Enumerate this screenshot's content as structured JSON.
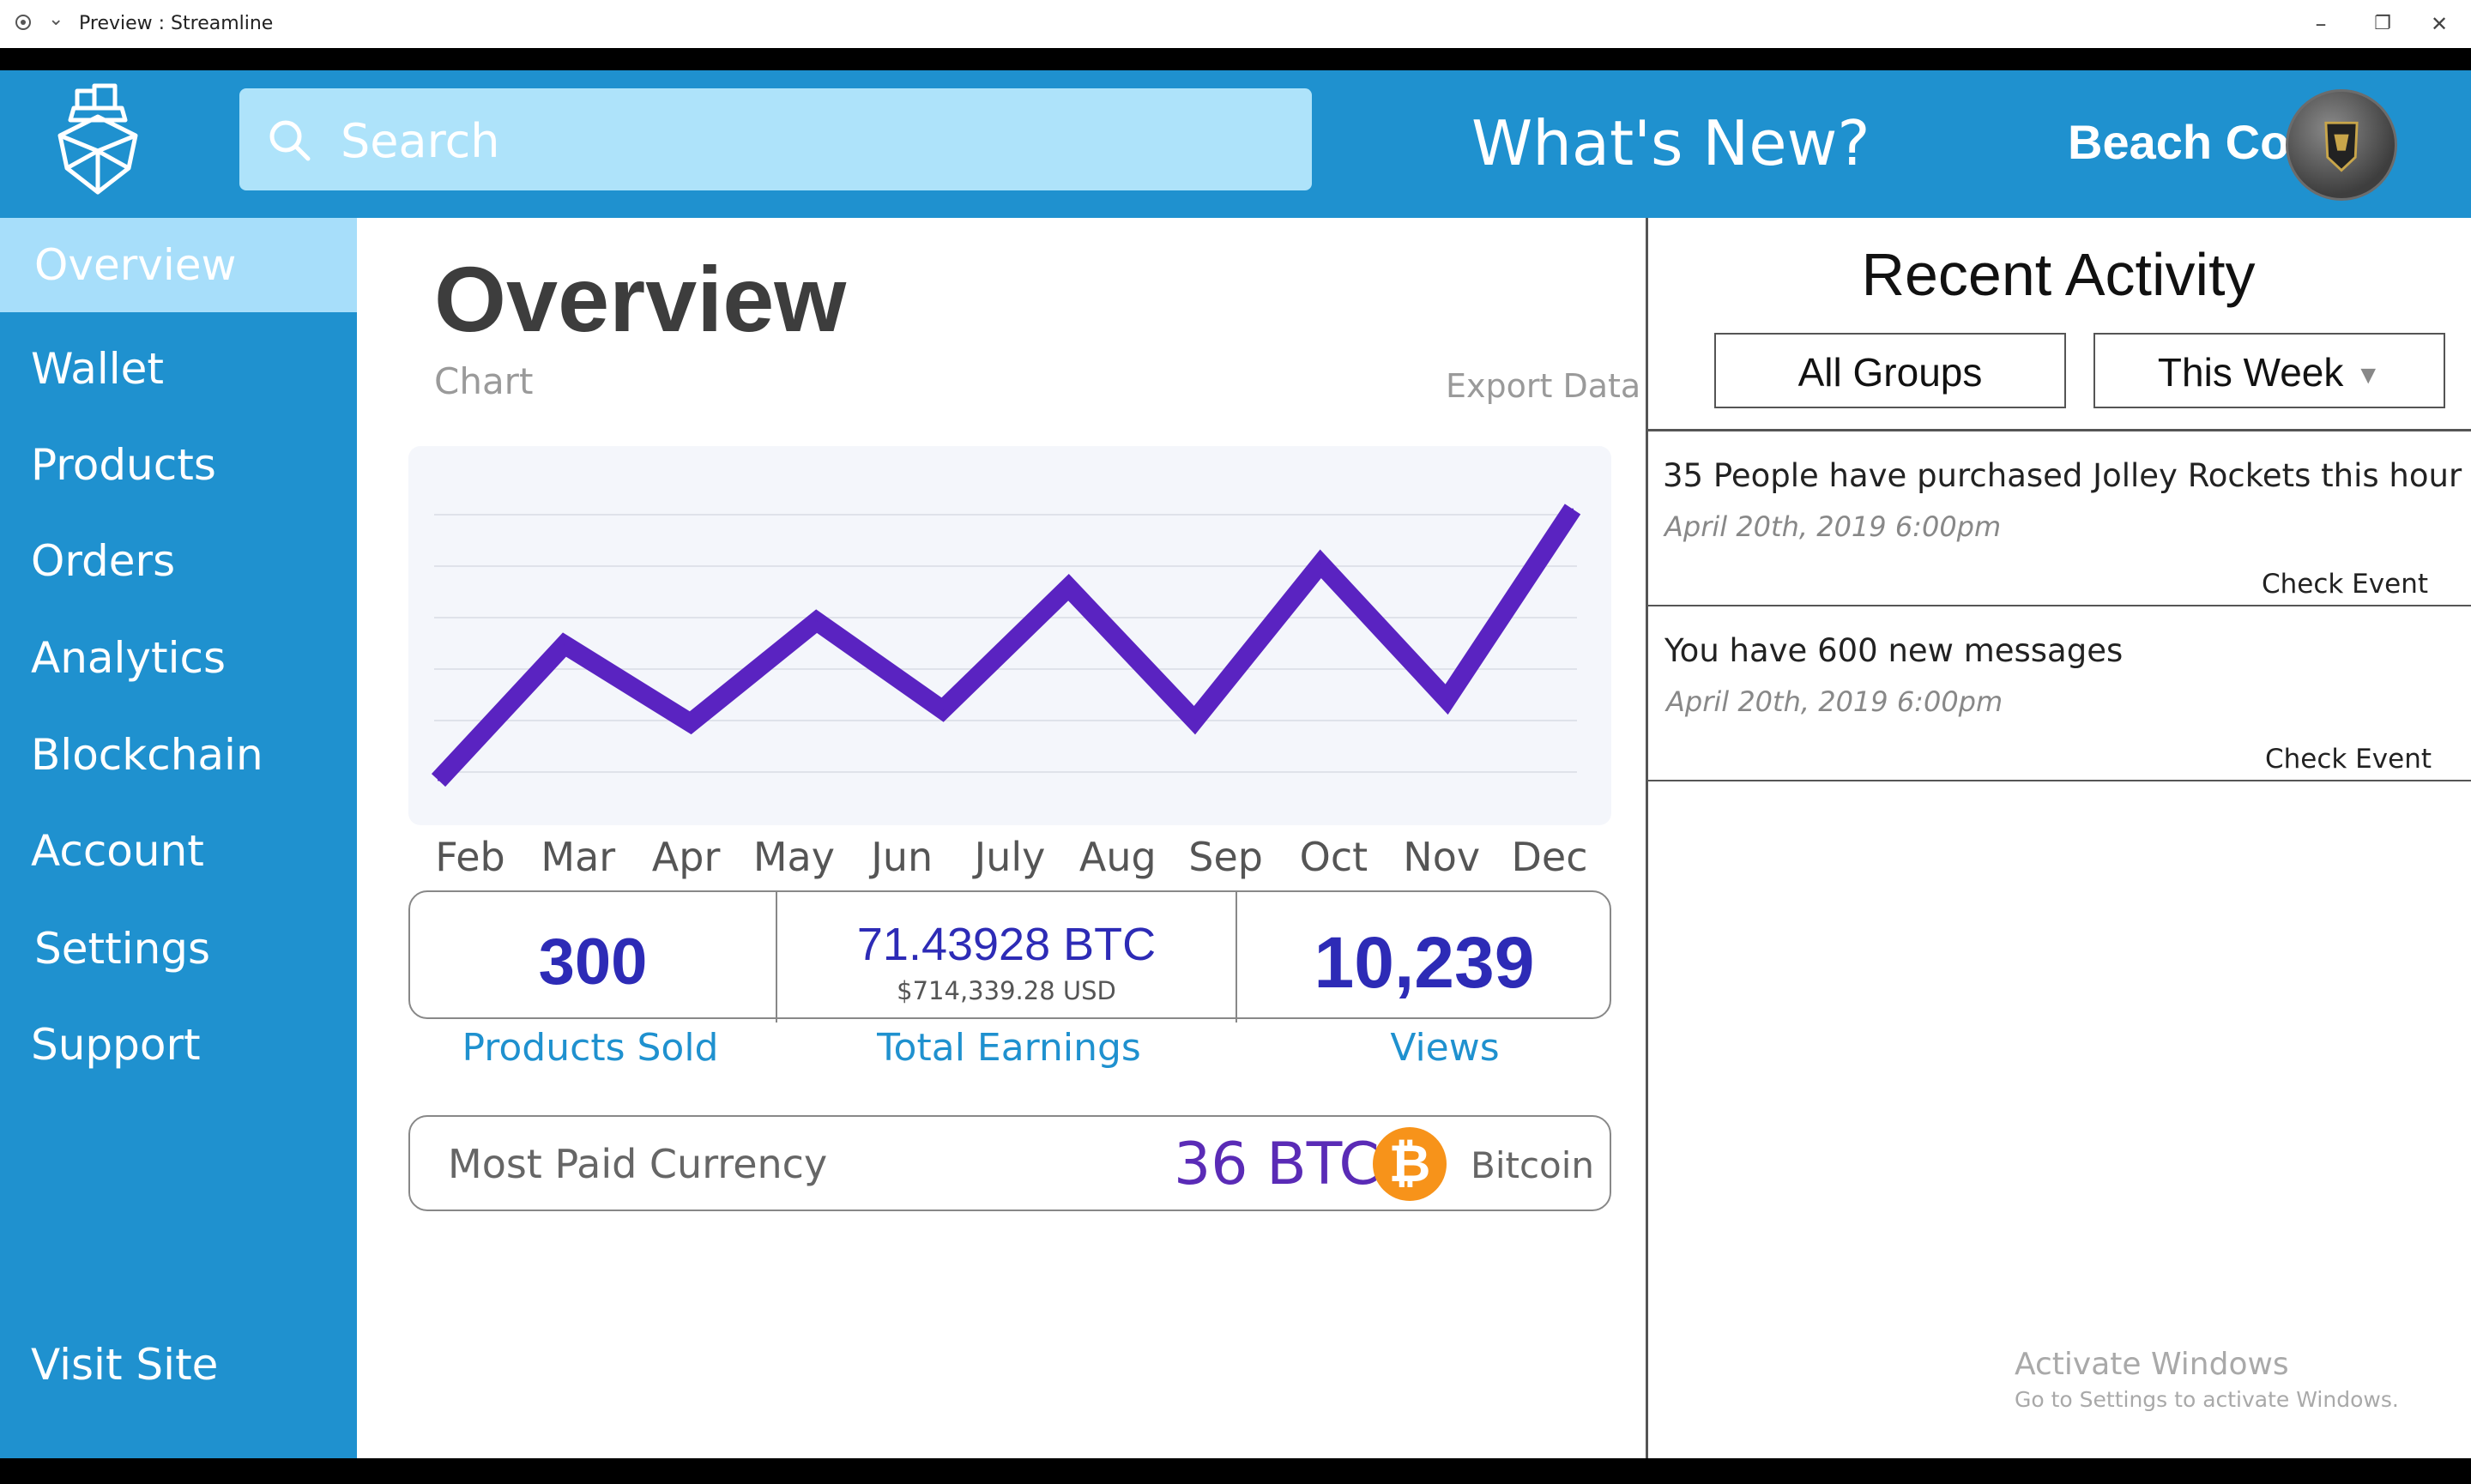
{
  "window": {
    "title": "Preview : Streamline",
    "minimize": "–",
    "maximize": "❐",
    "close": "✕"
  },
  "header": {
    "search_placeholder": "Search",
    "whats_new": "What's New?",
    "company": "Beach Co"
  },
  "sidebar": {
    "items": [
      {
        "label": "Overview",
        "active": true
      },
      {
        "label": "Wallet"
      },
      {
        "label": "Products"
      },
      {
        "label": "Orders"
      },
      {
        "label": "Analytics"
      },
      {
        "label": "Blockchain"
      },
      {
        "label": "Account"
      },
      {
        "label": "Settings"
      },
      {
        "label": "Support"
      }
    ],
    "footer": "Visit Site"
  },
  "main": {
    "title": "Overview",
    "chart_label": "Chart",
    "export": "Export Data",
    "stats": {
      "products_sold": "300",
      "products_sold_label": "Products Sold",
      "earnings_btc": "71.43928 BTC",
      "earnings_usd": "$714,339.28 USD",
      "earnings_label": "Total Earnings",
      "views": "10,239",
      "views_label": "Views"
    },
    "currency": {
      "label": "Most Paid Currency",
      "amount": "36 BTC",
      "symbol": "₿",
      "name": "Bitcoin"
    }
  },
  "chart_data": {
    "type": "line",
    "categories": [
      "Feb",
      "Mar",
      "Apr",
      "May",
      "Jun",
      "July",
      "Aug",
      "Sep",
      "Oct",
      "Nov",
      "Dec"
    ],
    "values": [
      10,
      62,
      32,
      71,
      37,
      84,
      33,
      93,
      41,
      114
    ],
    "ylim": [
      0,
      125
    ],
    "grid": true,
    "color": "#5a23c1"
  },
  "recent": {
    "title": "Recent Activity",
    "filter_group": "All Groups",
    "filter_time": "This Week",
    "events": [
      {
        "text": "35 People have purchased Jolley Rockets this hour",
        "date": "April 20th, 2019 6:00pm",
        "action": "Check Event"
      },
      {
        "text": "You have 600 new messages",
        "date": "April 20th, 2019 6:00pm",
        "action": "Check Event"
      }
    ]
  },
  "watermark": {
    "line1": "Activate Windows",
    "line2": "Go to Settings to activate Windows."
  }
}
